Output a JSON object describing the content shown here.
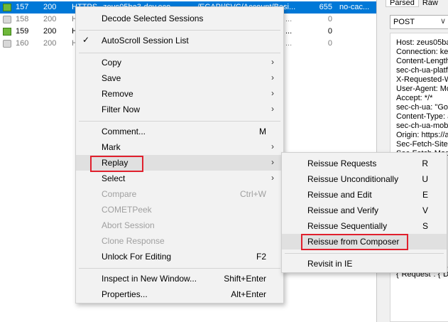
{
  "sessions": [
    {
      "id": "157",
      "result": "200",
      "protocol": "HTTPS",
      "host": "zeus05ba3-dev.eco...",
      "url": "/ECAPI/SVC/Account/Basi...",
      "body": "655",
      "caching": "no-cac...",
      "selected": true,
      "icon": "arrow-icon"
    },
    {
      "id": "158",
      "result": "200",
      "protocol": "H",
      "host": "",
      "url": "...",
      "body": "0",
      "caching": "",
      "selected": false,
      "icon": "lock-icon",
      "dim": true
    },
    {
      "id": "159",
      "result": "200",
      "protocol": "H",
      "host": "",
      "url": "...",
      "body": "0",
      "caching": "",
      "selected": false,
      "icon": "arrow-icon"
    },
    {
      "id": "160",
      "result": "200",
      "protocol": "H",
      "host": "",
      "url": "...",
      "body": "0",
      "caching": "",
      "selected": false,
      "icon": "lock-icon",
      "dim": true
    }
  ],
  "inspector": {
    "tabs": [
      "Parsed",
      "Raw"
    ],
    "method": "POST",
    "headers": [
      "Host: zeus05ba",
      "Connection: kee",
      "Content-Length",
      "sec-ch-ua-platfo",
      "X-Requested-W",
      "User-Agent: Mo",
      "Accept: */*",
      "sec-ch-ua: \"Goo",
      "Content-Type: a",
      "sec-ch-ua-mobil",
      "Origin: https://a",
      "Sec-Fetch-Site:",
      "Sec-Fetch-Mode"
    ],
    "body_preview": "{\"Request\": {\"D"
  },
  "context_menu": {
    "items": [
      {
        "label": "Decode Selected Sessions"
      },
      {
        "label": "AutoScroll Session List",
        "checked": true
      },
      {
        "label": "Copy",
        "submenu": true
      },
      {
        "label": "Save",
        "submenu": true
      },
      {
        "label": "Remove",
        "submenu": true
      },
      {
        "label": "Filter Now",
        "submenu": true
      },
      {
        "label": "Comment...",
        "shortcut": "M"
      },
      {
        "label": "Mark",
        "submenu": true
      },
      {
        "label": "Replay",
        "submenu": true,
        "highlighted": true
      },
      {
        "label": "Select",
        "submenu": true
      },
      {
        "label": "Compare",
        "shortcut": "Ctrl+W",
        "disabled": true
      },
      {
        "label": "COMETPeek",
        "disabled": true
      },
      {
        "label": "Abort Session",
        "disabled": true
      },
      {
        "label": "Clone Response",
        "disabled": true
      },
      {
        "label": "Unlock For Editing",
        "shortcut": "F2"
      },
      {
        "label": "Inspect in New Window...",
        "shortcut": "Shift+Enter"
      },
      {
        "label": "Properties...",
        "shortcut": "Alt+Enter"
      }
    ]
  },
  "replay_submenu": {
    "items": [
      {
        "label": "Reissue Requests",
        "shortcut": "R"
      },
      {
        "label": "Reissue Unconditionally",
        "shortcut": "U"
      },
      {
        "label": "Reissue and Edit",
        "shortcut": "E"
      },
      {
        "label": "Reissue and Verify",
        "shortcut": "V"
      },
      {
        "label": "Reissue Sequentially",
        "shortcut": "S"
      },
      {
        "label": "Reissue from Composer",
        "highlighted": true
      },
      {
        "label": "Revisit in IE"
      }
    ]
  },
  "colors": {
    "selection": "#0078d7",
    "highlight_box": "#e0202d",
    "menu_bg": "#f2f2f2"
  },
  "arrow_glyph": "›",
  "check_glyph": "✓",
  "chevron_glyph": "∨"
}
